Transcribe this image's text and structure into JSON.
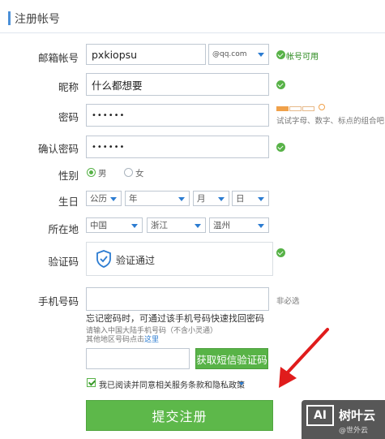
{
  "header": {
    "title": "注册帐号"
  },
  "labels": {
    "email": "邮箱帐号",
    "nickname": "昵称",
    "password": "密码",
    "confirm": "确认密码",
    "gender": "性别",
    "birthday": "生日",
    "location": "所在地",
    "captcha": "验证码",
    "phone": "手机号码"
  },
  "email": {
    "value": "pxkiopsu",
    "domain": "@qq.com",
    "status": "帐号可用"
  },
  "nickname": {
    "value": "什么都想要"
  },
  "password": {
    "value": "••••••",
    "hint": "试试字母、数字、标点的组合吧"
  },
  "confirm": {
    "value": "••••••"
  },
  "gender": {
    "male": "男",
    "female": "女",
    "selected": "male"
  },
  "birthday": {
    "calendar": "公历",
    "year": "年",
    "month": "月",
    "day": "日"
  },
  "location": {
    "country": "中国",
    "province": "浙江",
    "city": "温州"
  },
  "captcha": {
    "text": "验证通过"
  },
  "phone": {
    "value": "",
    "optional": "非必选",
    "note": "忘记密码时，可通过该手机号码快速找回密码",
    "sub1": "请输入中国大陆手机号码（不含小灵通）",
    "sub2_prefix": "其他地区号码点击",
    "sub2_link": "这里"
  },
  "sms": {
    "button": "获取短信验证码"
  },
  "agreement": {
    "text": "我已阅读并同意相关服务条款和隐私政策"
  },
  "submit": {
    "label": "提交注册"
  },
  "watermark": {
    "logo": "AI",
    "name": "树叶云",
    "sub": "@世外云"
  },
  "colors": {
    "green": "#58b347",
    "blue": "#2c7cd1"
  }
}
